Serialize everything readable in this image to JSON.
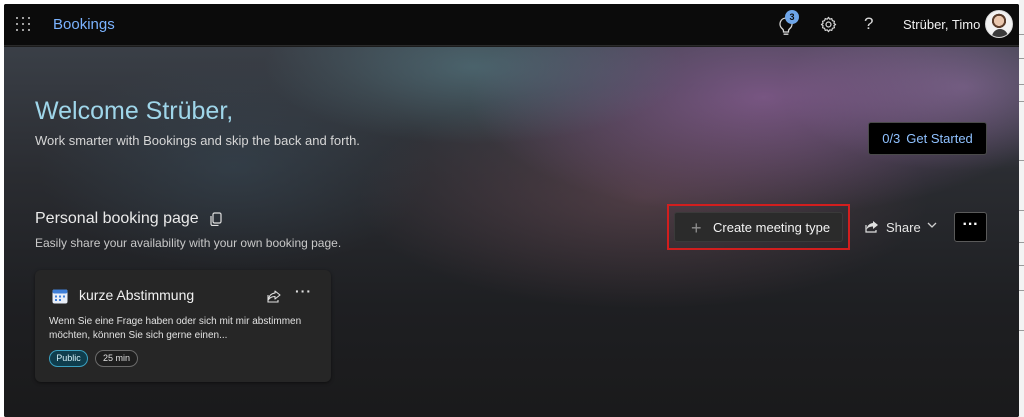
{
  "topbar": {
    "app_name": "Bookings",
    "notification_count": "3",
    "help_label": "?",
    "user_name": "Strüber, Timo"
  },
  "hero": {
    "welcome": "Welcome Strüber,",
    "subtitle": "Work smarter with Bookings and skip the back and forth.",
    "get_started": {
      "progress": "0/3",
      "label": "Get Started"
    }
  },
  "booking_page": {
    "title": "Personal booking page",
    "subtitle": "Easily share your availability with your own booking page.",
    "create_button": "Create meeting type",
    "share_button": "Share",
    "more_button": "···"
  },
  "card": {
    "title": "kurze Abstimmung",
    "description": "Wenn Sie eine Frage haben oder sich mit mir abstimmen möchten, können Sie sich gerne einen...",
    "more": "···",
    "visibility": "Public",
    "duration": "25 min"
  },
  "colors": {
    "accent": "#7bb3ff",
    "welcome": "#9fd6ea",
    "highlight": "#d21e1e"
  }
}
